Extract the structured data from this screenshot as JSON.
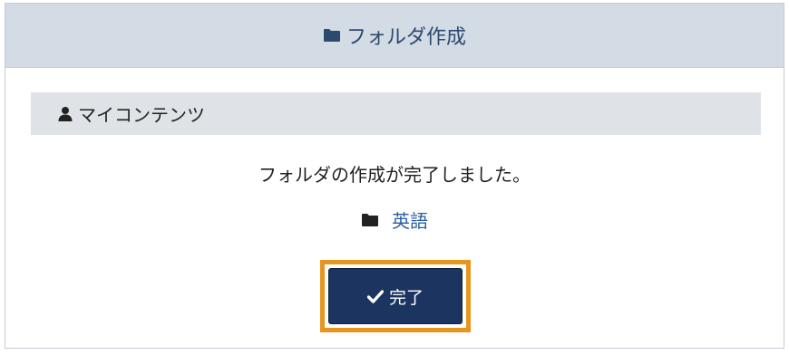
{
  "dialog": {
    "title": "フォルダ作成",
    "title_icon": "folder-icon"
  },
  "section": {
    "label": "マイコンテンツ",
    "icon": "user-icon"
  },
  "message": "フォルダの作成が完了しました。",
  "folder": {
    "name": "英語",
    "icon": "folder-icon"
  },
  "done_button": {
    "label": "完了",
    "icon": "check-icon"
  },
  "colors": {
    "header_bg": "#d3dce5",
    "header_text": "#2c4a6e",
    "section_bg": "#dfe2e6",
    "link": "#2a5d9f",
    "button_bg": "#1c3560",
    "focus_ring": "#e8951f"
  }
}
